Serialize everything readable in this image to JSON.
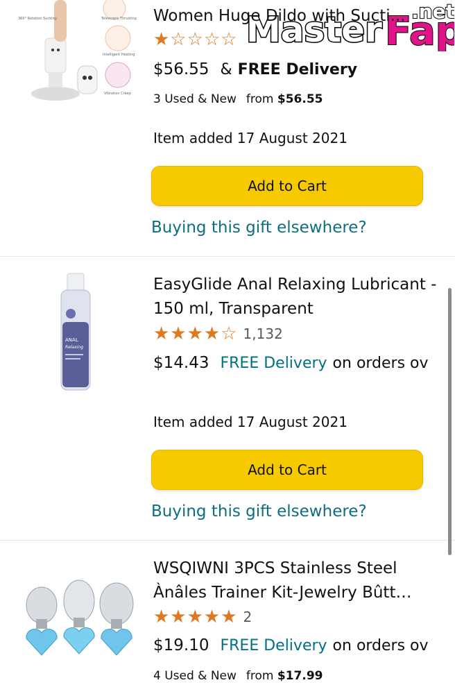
{
  "watermark": {
    "main": "Master",
    "accent": "Fap",
    "suffix": ".net"
  },
  "items": [
    {
      "title": "Women Huge Dildo with Sucti...",
      "stars": "★☆☆☆☆",
      "rating_count": "",
      "price": "$56.55",
      "delivery_prefix": "&",
      "delivery": "FREE Delivery",
      "offers_text": "3 Used & New",
      "offers_from_label": "from",
      "offers_from_price": "$56.55",
      "added": "Item added 17 August 2021",
      "cart_label": "Add to Cart",
      "gift_link": "Buying this gift elsewhere?",
      "thumb_labels": [
        "360° Rotation Sucking",
        "Telescopic Thrusting",
        "Intelligent Heating",
        "Vibration Creep"
      ]
    },
    {
      "title": "EasyGlide Anal Relaxing Lubricant - 150 ml, Transparent",
      "stars": "★★★★☆",
      "rating_count": "1,132",
      "price": "$14.43",
      "delivery": "FREE Delivery",
      "delivery_suffix": "on orders ov",
      "added": "Item added 17 August 2021",
      "cart_label": "Add to Cart",
      "gift_link": "Buying this gift elsewhere?",
      "thumb_labels": [
        "ANAL",
        "Relaxing"
      ]
    },
    {
      "title": "WSQIWNI 3PCS Stainless Steel Ànâles Trainer Kit-Jewelry Bûtt…",
      "stars": "★★★★★",
      "rating_count": "2",
      "price": "$19.10",
      "delivery": "FREE Delivery",
      "delivery_suffix": "on orders ov",
      "offers_text": "4 Used & New",
      "offers_from_label": "from",
      "offers_from_price": "$17.99"
    }
  ],
  "colors": {
    "accent_button": "#f7ca00",
    "link": "#0e6e80",
    "star": "#de7921",
    "watermark_accent": "#e0138a"
  }
}
